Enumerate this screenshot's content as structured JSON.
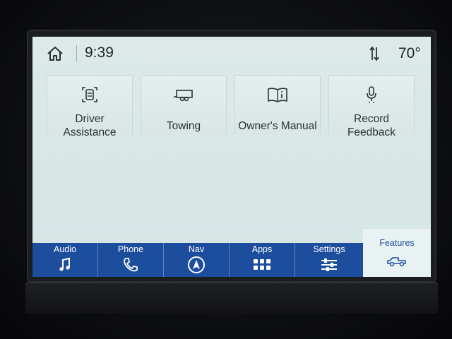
{
  "status_bar": {
    "time": "9:39",
    "temperature": "70°",
    "icons": [
      "home-icon",
      "sync-icon"
    ]
  },
  "tiles": [
    {
      "label": "Driver\nAssistance",
      "icon": "driver-assistance-icon"
    },
    {
      "label": "Towing",
      "icon": "trailer-icon"
    },
    {
      "label": "Owner's Manual",
      "icon": "manual-book-icon"
    },
    {
      "label": "Record\nFeedback",
      "icon": "microphone-icon"
    }
  ],
  "nav": {
    "items": [
      {
        "label": "Audio",
        "icon": "music-note-icon"
      },
      {
        "label": "Phone",
        "icon": "phone-icon"
      },
      {
        "label": "Nav",
        "icon": "navigation-arrow-icon"
      },
      {
        "label": "Apps",
        "icon": "apps-grid-icon"
      },
      {
        "label": "Settings",
        "icon": "sliders-icon"
      }
    ],
    "active": {
      "label": "Features",
      "icon": "truck-icon"
    }
  },
  "colors": {
    "nav_blue": "#1d4e9e",
    "screen_bg": "#d8e7e6",
    "text_dark": "#2a2f33"
  }
}
